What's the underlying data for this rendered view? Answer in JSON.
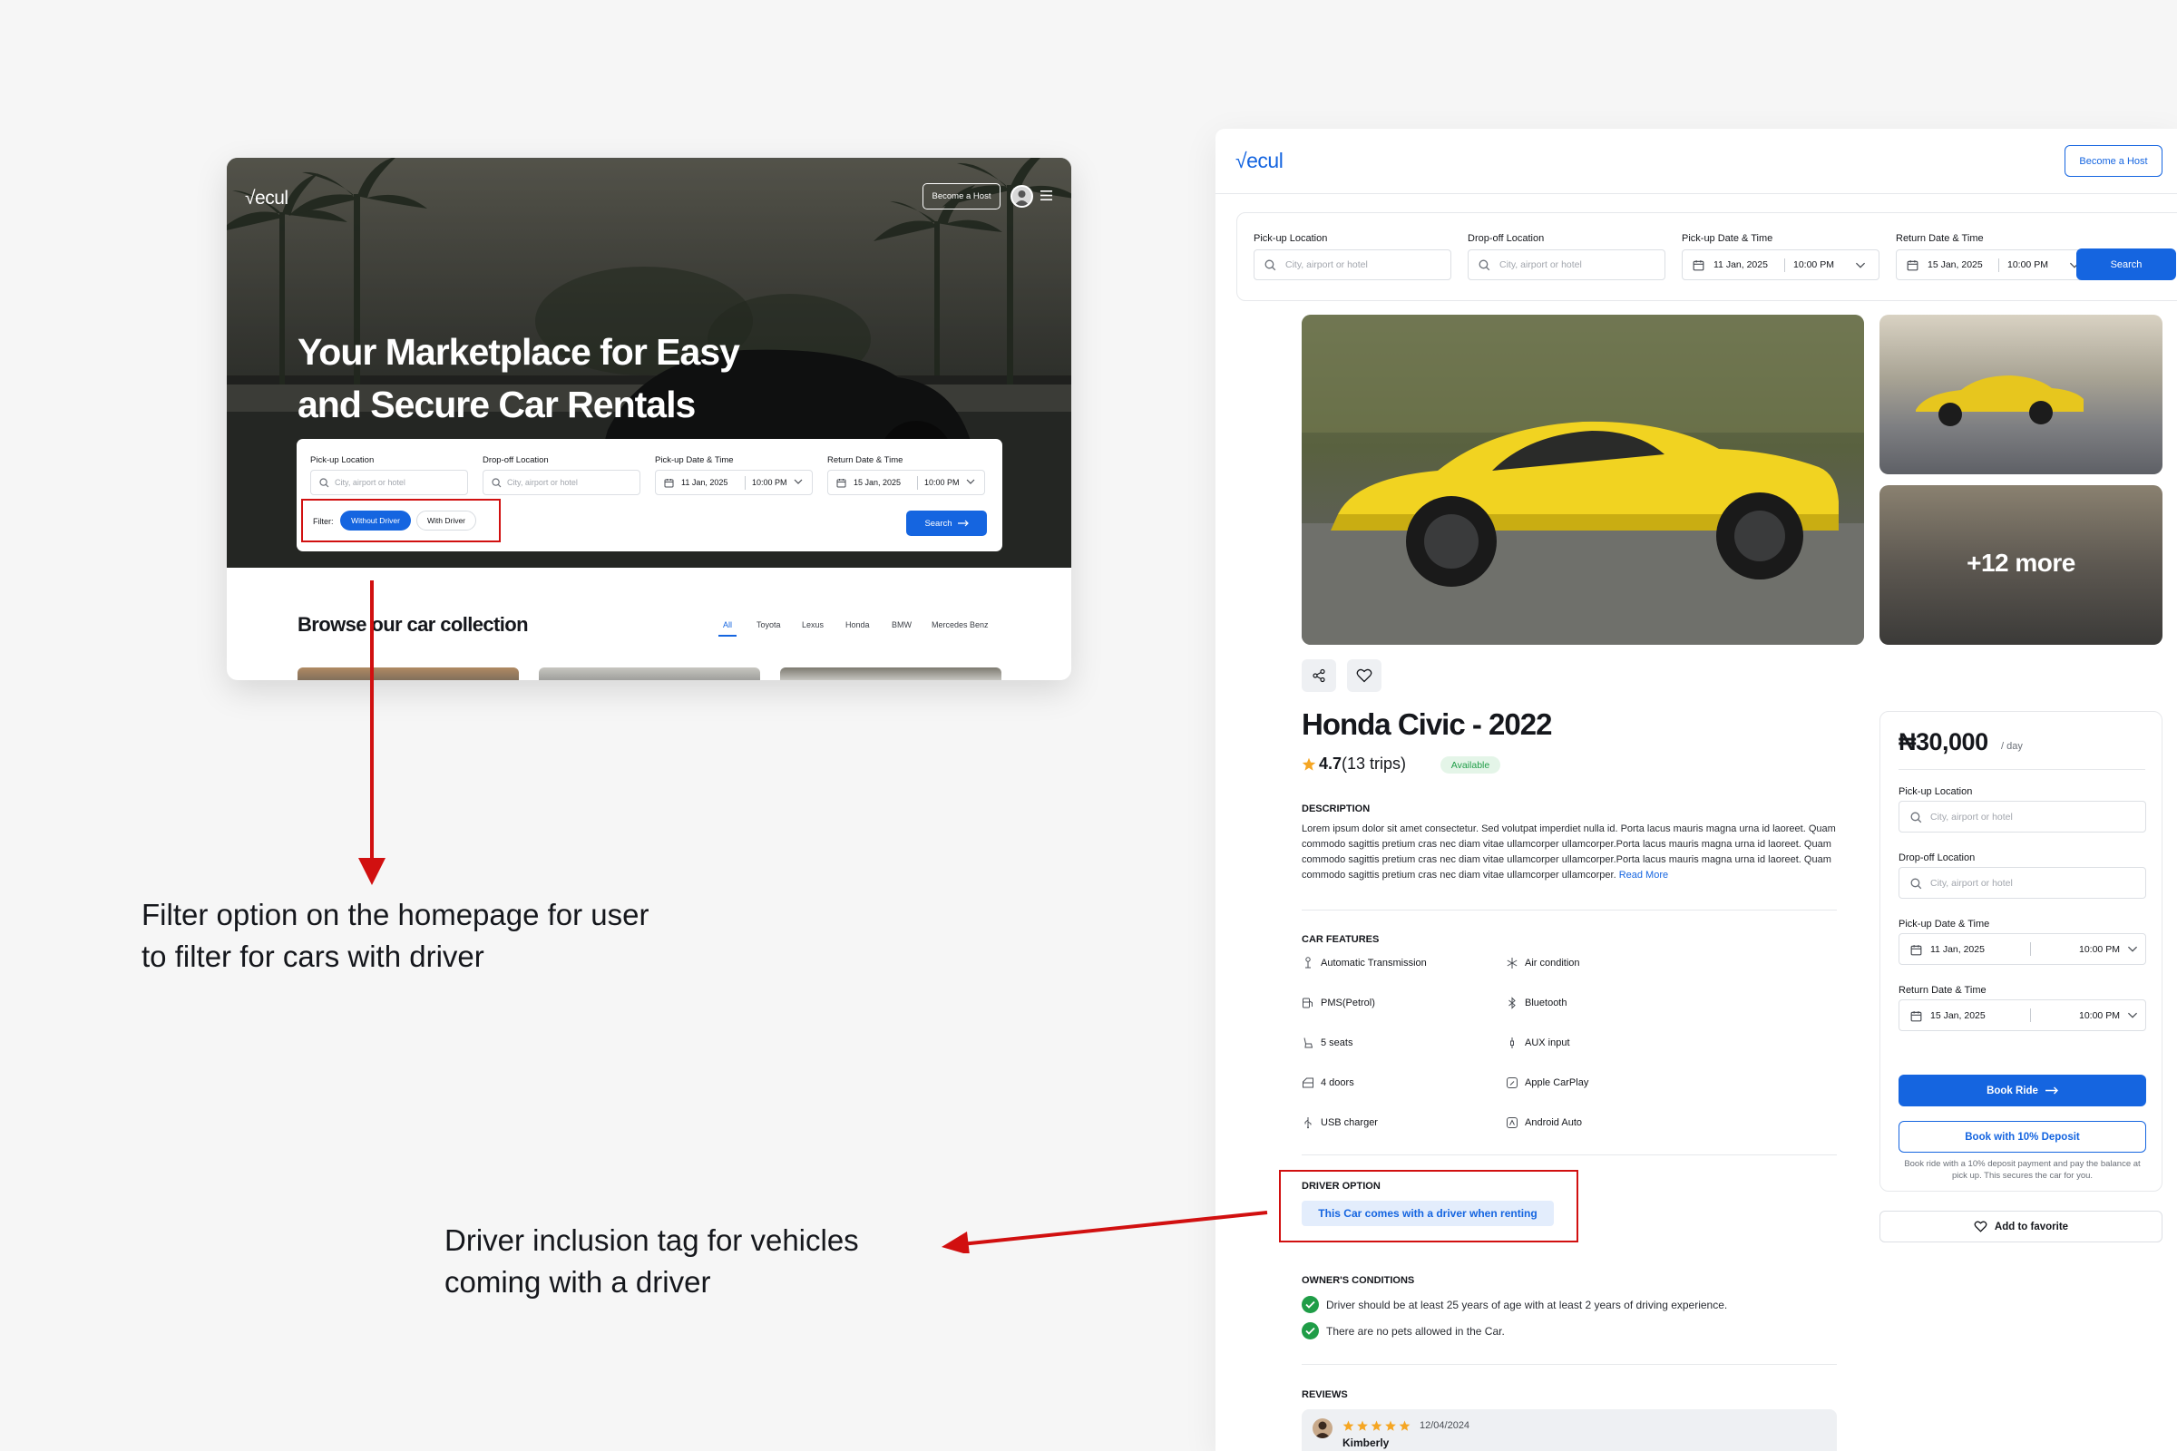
{
  "brand": {
    "logo": "√ecul"
  },
  "home": {
    "become_host": "Become a Host",
    "hero_title": "Your Marketplace for Easy and Secure Car Rentals",
    "search": {
      "pickup_location_label": "Pick-up Location",
      "dropoff_location_label": "Drop-off Location",
      "pickup_datetime_label": "Pick-up Date & Time",
      "return_datetime_label": "Return Date & Time",
      "location_placeholder": "City, airport or hotel",
      "pickup_date": "11 Jan, 2025",
      "pickup_time": "10:00 PM",
      "return_date": "15 Jan, 2025",
      "return_time": "10:00 PM",
      "search_label": "Search"
    },
    "filter": {
      "label": "Filter:",
      "options": [
        "Without Driver",
        "With Driver"
      ],
      "selected": "Without Driver"
    },
    "browse_title": "Browse our car collection",
    "brand_tabs": [
      "All",
      "Toyota",
      "Lexus",
      "Honda",
      "BMW",
      "Mercedes Benz"
    ]
  },
  "product": {
    "become_host": "Become a Host",
    "search": {
      "pickup_location_label": "Pick-up Location",
      "dropoff_location_label": "Drop-off Location",
      "pickup_datetime_label": "Pick-up Date & Time",
      "return_datetime_label": "Return Date & Time",
      "location_placeholder": "City, airport or hotel",
      "pickup_date": "11 Jan, 2025",
      "pickup_time": "10:00 PM",
      "return_date": "15 Jan, 2025",
      "return_time": "10:00 PM",
      "search_label": "Search"
    },
    "gallery_more": "+12 more",
    "title": "Honda Civic - 2022",
    "rating": "4.7",
    "trips": "(13 trips)",
    "status": "Available",
    "description_heading": "DESCRIPTION",
    "description": "Lorem ipsum dolor sit amet consectetur. Sed volutpat imperdiet nulla id. Porta lacus mauris magna urna id laoreet. Quam commodo sagittis pretium cras nec diam vitae ullamcorper ullamcorper.Porta lacus mauris magna urna id laoreet. Quam commodo sagittis pretium cras nec diam vitae ullamcorper ullamcorper.Porta lacus mauris magna urna id laoreet. Quam commodo sagittis pretium cras nec diam vitae ullamcorper ullamcorper.",
    "read_more": "Read More",
    "features_heading": "CAR FEATURES",
    "features_left": [
      {
        "icon": "gear-shift-icon",
        "label": "Automatic Transmission"
      },
      {
        "icon": "fuel-pump-icon",
        "label": "PMS(Petrol)"
      },
      {
        "icon": "seat-icon",
        "label": "5 seats"
      },
      {
        "icon": "car-door-icon",
        "label": "4 doors"
      },
      {
        "icon": "usb-icon",
        "label": "USB charger"
      }
    ],
    "features_right": [
      {
        "icon": "snowflake-icon",
        "label": "Air condition"
      },
      {
        "icon": "bluetooth-icon",
        "label": "Bluetooth"
      },
      {
        "icon": "aux-plug-icon",
        "label": "AUX input"
      },
      {
        "icon": "apple-carplay-icon",
        "label": "Apple CarPlay"
      },
      {
        "icon": "android-auto-icon",
        "label": "Android Auto"
      }
    ],
    "driver_heading": "DRIVER OPTION",
    "driver_tag": "This Car comes with a driver when renting",
    "conditions_heading": "OWNER'S CONDITIONS",
    "conditions": [
      "Driver should be at least 25 years of age with at least 2 years of driving experience.",
      "There are no pets allowed in the Car."
    ],
    "reviews_heading": "REVIEWS",
    "review": {
      "date": "12/04/2024",
      "name": "Kimberly",
      "stars": 5
    },
    "booking": {
      "price": "₦30,000",
      "per_day": "/ day",
      "pickup_location_label": "Pick-up Location",
      "dropoff_location_label": "Drop-off Location",
      "pickup_datetime_label": "Pick-up Date & Time",
      "return_datetime_label": "Return Date & Time",
      "location_placeholder": "City, airport or hotel",
      "pickup_date": "11 Jan, 2025",
      "pickup_time": "10:00 PM",
      "return_date": "15 Jan, 2025",
      "return_time": "10:00 PM",
      "book_ride": "Book Ride",
      "book_deposit": "Book with 10% Deposit",
      "deposit_note": "Book ride with a 10% deposit payment and pay the balance at pick up. This secures the car for you.",
      "add_favorite": "Add to favorite"
    }
  },
  "annotations": {
    "filter_note": "Filter option on the homepage for user to filter for cars with driver",
    "driver_note": "Driver inclusion tag for vehicles coming with a driver",
    "highlight_color": "#d11010"
  },
  "colors": {
    "primary": "#1565e0",
    "success": "#1f9d47",
    "star": "#f5a623",
    "annotation": "#d11010"
  }
}
